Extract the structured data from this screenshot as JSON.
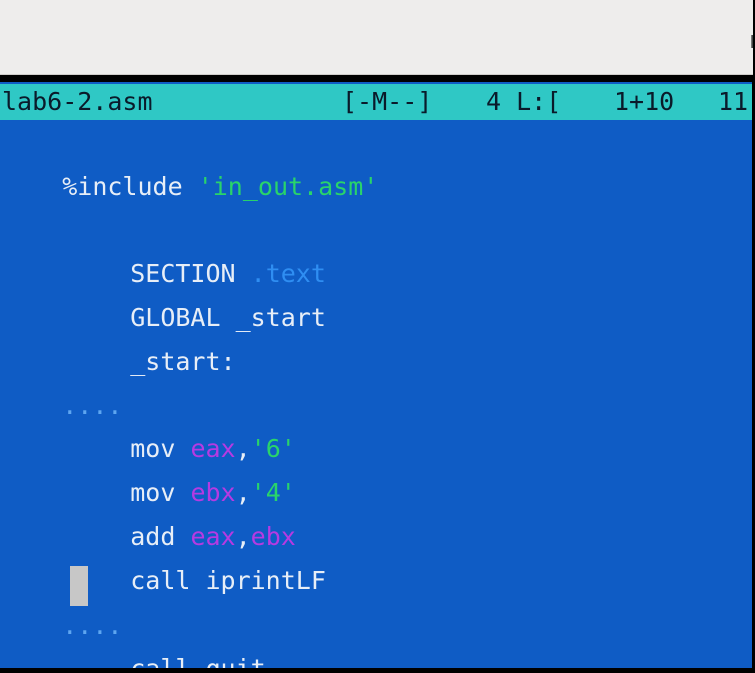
{
  "status_bar": {
    "filename": "lab6-2.asm",
    "mode": "[-M--]",
    "info": "4 L:[",
    "cursor": "1+10",
    "extra": "11"
  },
  "topbar": {
    "glyph": "r"
  },
  "lines": {
    "include_kw": "%include",
    "include_space": " ",
    "include_file": "'in_out.asm'",
    "section_kw": "SECTION",
    "section_space": " ",
    "section_name": ".text",
    "global_line": "GLOBAL _start",
    "start_label": "_start:",
    "tab_dots": "....",
    "mov1_kw": "mov ",
    "mov1_reg": "eax",
    "mov1_comma": ",",
    "mov1_val": "'6'",
    "mov2_kw": "mov ",
    "mov2_reg": "ebx",
    "mov2_comma": ",",
    "mov2_val": "'4'",
    "add_kw": "add ",
    "add_reg1": "eax",
    "add_comma": ",",
    "add_reg2": "ebx",
    "call1": "call iprintLF",
    "tab_dots2": "....",
    "call2": "call quit"
  },
  "colors": {
    "editor_bg": "#0f5cc5",
    "status_bg": "#2fc8c5",
    "string": "#29d46a",
    "register": "#b63ae2",
    "section_name": "#2f8ef2",
    "cursor": "#c7c7c7"
  }
}
